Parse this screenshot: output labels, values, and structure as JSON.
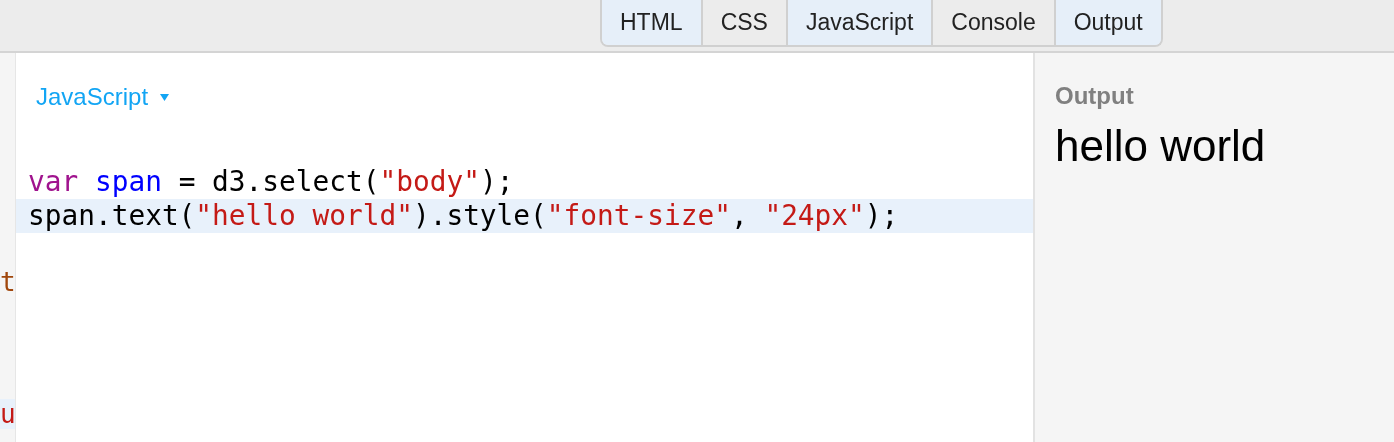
{
  "tabs": [
    {
      "label": "HTML",
      "selected": true
    },
    {
      "label": "CSS",
      "selected": false
    },
    {
      "label": "JavaScript",
      "selected": true
    },
    {
      "label": "Console",
      "selected": false
    },
    {
      "label": "Output",
      "selected": true
    }
  ],
  "side_strip": [
    {
      "text": "t",
      "kind": "keyword",
      "active": false
    },
    {
      "text": "u",
      "kind": "string",
      "active": true
    }
  ],
  "editor": {
    "language": "JavaScript",
    "lines": [
      {
        "active": false,
        "tokens": [
          {
            "text": "var ",
            "kind": "keyword"
          },
          {
            "text": "span",
            "kind": "variable"
          },
          {
            "text": " = d3.select(",
            "kind": "plain"
          },
          {
            "text": "\"body\"",
            "kind": "string"
          },
          {
            "text": ");",
            "kind": "plain"
          }
        ]
      },
      {
        "active": true,
        "tokens": [
          {
            "text": "span.text(",
            "kind": "plain"
          },
          {
            "text": "\"hello world\"",
            "kind": "string"
          },
          {
            "text": ").style(",
            "kind": "plain"
          },
          {
            "text": "\"font-size\"",
            "kind": "string"
          },
          {
            "text": ", ",
            "kind": "plain"
          },
          {
            "text": "\"24px\"",
            "kind": "string"
          },
          {
            "text": ");",
            "kind": "plain"
          }
        ]
      }
    ]
  },
  "output": {
    "title": "Output",
    "text": "hello world"
  }
}
